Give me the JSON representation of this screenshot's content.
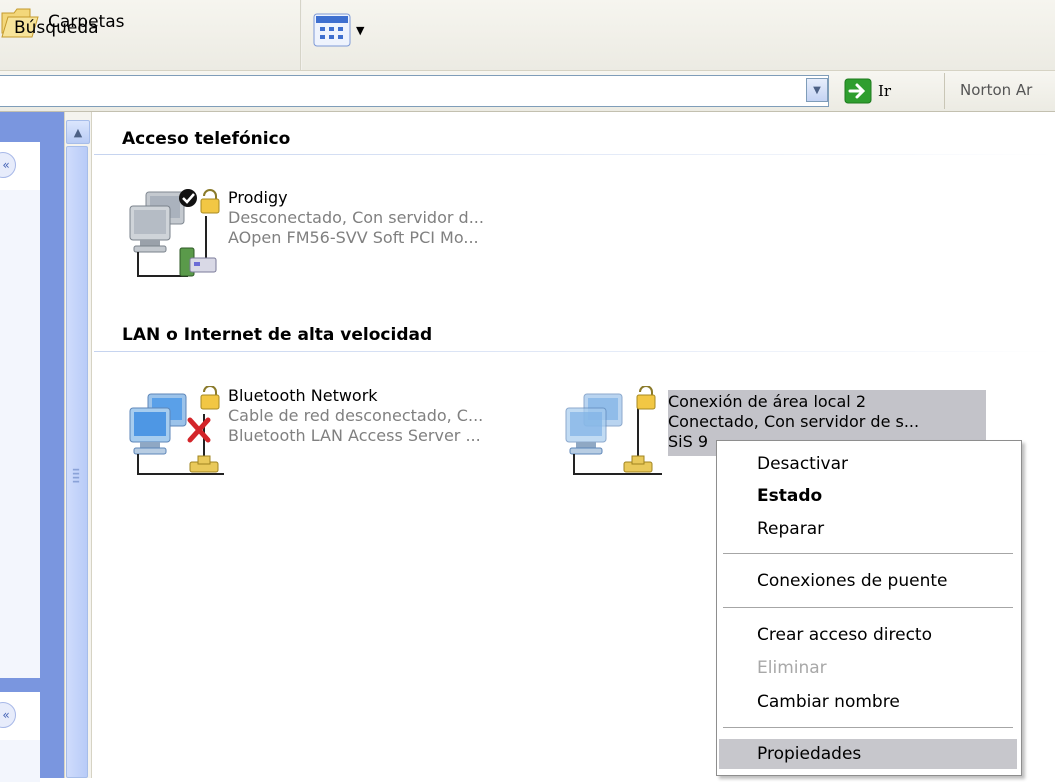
{
  "toolbar": {
    "search_label": "Búsqueda",
    "folders_label": "Carpetas"
  },
  "address_bar": {
    "go_label": "Ir",
    "norton_label": "Norton Ar"
  },
  "groups": {
    "dialup": "Acceso telefónico",
    "lan": "LAN o Internet de alta velocidad"
  },
  "connections": {
    "prodigy": {
      "name": "Prodigy",
      "status": "Desconectado, Con servidor d...",
      "device": "AOpen FM56-SVV Soft PCI Mo..."
    },
    "bluetooth": {
      "name": "Bluetooth Network",
      "status": "Cable de red desconectado, C...",
      "device": "Bluetooth LAN Access Server ..."
    },
    "lan2": {
      "name": "Conexión de área local 2",
      "status": "Conectado, Con servidor de s...",
      "device": "SiS 9"
    }
  },
  "context_menu": {
    "items": [
      {
        "label": "Desactivar"
      },
      {
        "label": "Estado",
        "bold": true
      },
      {
        "label": "Reparar"
      },
      {
        "label": "Conexiones de puente"
      },
      {
        "label": "Crear acceso directo"
      },
      {
        "label": "Eliminar",
        "disabled": true
      },
      {
        "label": "Cambiar nombre"
      },
      {
        "label": "Propiedades",
        "highlighted": true
      }
    ]
  },
  "icons": {
    "folders": "folder-icon",
    "views": "views-icon",
    "go": "go-arrow-icon",
    "dialup_connection": "dialup-connection-icon",
    "lan_connection": "lan-connection-icon",
    "lock": "lock-icon",
    "check": "check-icon",
    "disconnected": "red-x-icon"
  },
  "colors": {
    "task_pane": "#7a96df",
    "selection": "#c3c3c9",
    "menu_highlight": "#c7c7cc",
    "go_green": "#2f9e2f"
  }
}
